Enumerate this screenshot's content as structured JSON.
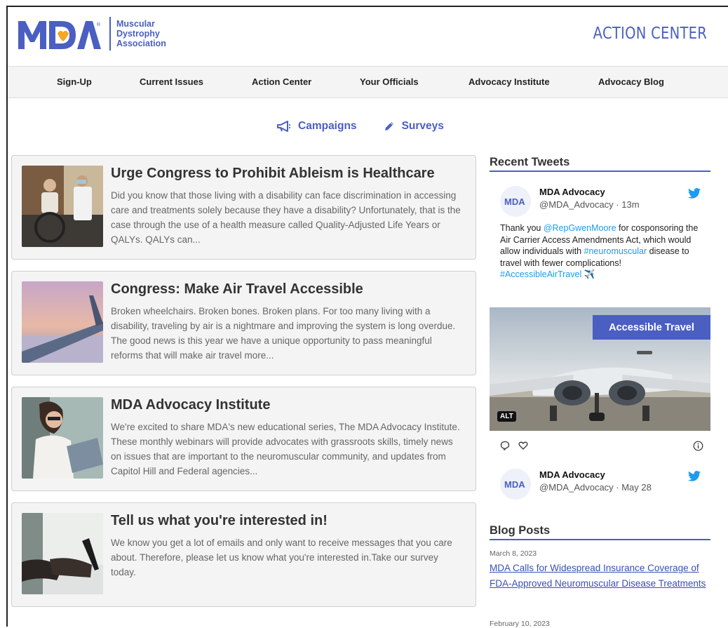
{
  "brand": {
    "logo_alt": "MDA",
    "org_lines": [
      "Muscular",
      "Dystrophy",
      "Association"
    ],
    "section_title": "ACTION CENTER",
    "brand_color": "#4a5fc1"
  },
  "nav": {
    "items": [
      "Sign-Up",
      "Current Issues",
      "Action Center",
      "Your Officials",
      "Advocacy Institute",
      "Advocacy Blog"
    ]
  },
  "subnav": {
    "campaigns_label": "Campaigns",
    "campaigns_icon": "megaphone-icon",
    "surveys_label": "Surveys",
    "surveys_icon": "pencil-icon"
  },
  "campaigns": [
    {
      "title": "Urge Congress to Prohibit Ableism is Healthcare",
      "summary": "Did you know that those living with a disability can face discrimination in accessing care and treatments solely because they have a disability? Unfortunately, that is the case through the use of a health measure called Quality-Adjusted Life Years or QALYs. QALYs can..."
    },
    {
      "title": "Congress: Make Air Travel Accessible",
      "summary": "Broken wheelchairs. Broken bones. Broken plans. For too many living with a disability, traveling by air is a nightmare and improving the system is long overdue. The good news is this year we have a unique opportunity to pass meaningful reforms that will make air travel more..."
    },
    {
      "title": "MDA Advocacy Institute",
      "summary": "We're excited to share MDA's new educational series, The MDA Advocacy Institute. These monthly webinars will provide advocates with grassroots skills, timely news on issues that are important to the neuromuscular community, and updates from Capitol Hill and Federal agencies..."
    },
    {
      "title": "Tell us what you're interested in!",
      "summary": "We know you get a lot of emails and only want to receive messages that you care about. Therefore, please let us know what you're interested in.Take our survey today."
    }
  ],
  "tweets": {
    "heading": "Recent Tweets",
    "items": [
      {
        "name": "MDA Advocacy",
        "handle": "@MDA_Advocacy · 13m",
        "text_parts": [
          {
            "t": "Thank you ",
            "link": false
          },
          {
            "t": "@RepGwenMoore",
            "link": true
          },
          {
            "t": " for cosponsoring the Air Carrier Access Amendments Act, which would allow individuals with ",
            "link": false
          },
          {
            "t": "#neuromuscular",
            "link": true
          },
          {
            "t": " disease to travel with fewer complications! ",
            "link": false
          },
          {
            "t": "#AccessibleAirTravel",
            "link": true
          },
          {
            "t": " ✈️",
            "link": false
          }
        ],
        "image_banner": "Accessible Travel",
        "image_alt_badge": "ALT"
      },
      {
        "name": "MDA Advocacy",
        "handle": "@MDA_Advocacy · May 28"
      }
    ]
  },
  "blog": {
    "heading": "Blog Posts",
    "posts": [
      {
        "date": "March 8, 2023",
        "title": "MDA Calls for Widespread Insurance Coverage of FDA-Approved Neuromuscular Disease Treatments"
      },
      {
        "date": "February 10, 2023",
        "title": ""
      }
    ]
  }
}
